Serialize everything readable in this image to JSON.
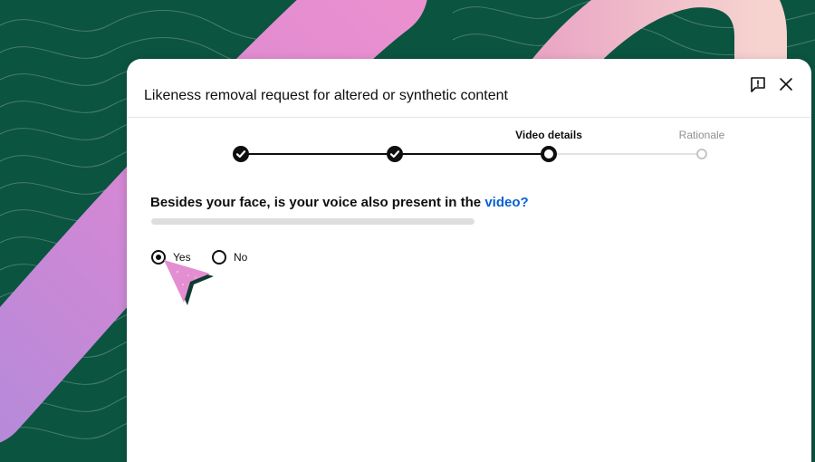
{
  "dialog": {
    "title": "Likeness removal request for altered or synthetic content",
    "feedback_icon": "feedback-icon",
    "close_icon": "close-icon"
  },
  "stepper": {
    "steps": [
      {
        "label": "",
        "state": "complete"
      },
      {
        "label": "",
        "state": "complete"
      },
      {
        "label": "Video details",
        "state": "current"
      },
      {
        "label": "Rationale",
        "state": "pending"
      }
    ]
  },
  "question": {
    "text": "Besides your face, is your voice also present in the ",
    "link_text": "video?"
  },
  "options": [
    {
      "label": "Yes",
      "selected": true
    },
    {
      "label": "No",
      "selected": false
    }
  ],
  "colors": {
    "background": "#0b5440",
    "link": "#065fd4",
    "decoration_pink": "#e48ed2",
    "decoration_peach": "#f1c7c7"
  }
}
